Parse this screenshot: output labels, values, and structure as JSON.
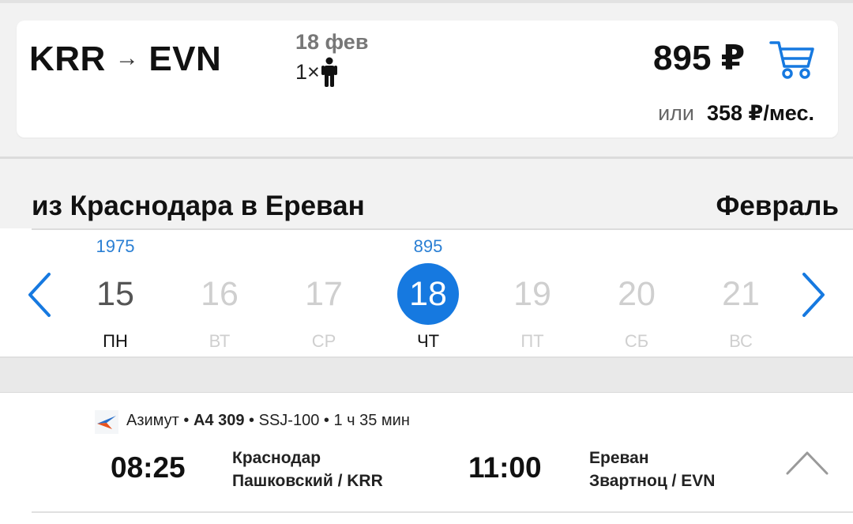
{
  "summary": {
    "origin": "KRR",
    "arrow": "→",
    "destination": "EVN",
    "date": "18 фев",
    "passengers": "1×",
    "price": "895 ₽",
    "installment_prefix": "или",
    "installment_amount": "358 ₽/мес."
  },
  "section": {
    "route_title": "из Краснодара в Ереван",
    "month": "Февраль"
  },
  "calendar": {
    "days": [
      {
        "price": "1975",
        "num": "15",
        "weekday": "ПН",
        "state": "available"
      },
      {
        "price": "",
        "num": "16",
        "weekday": "ВТ",
        "state": "disabled"
      },
      {
        "price": "",
        "num": "17",
        "weekday": "СР",
        "state": "disabled"
      },
      {
        "price": "895",
        "num": "18",
        "weekday": "ЧТ",
        "state": "selected"
      },
      {
        "price": "",
        "num": "19",
        "weekday": "ПТ",
        "state": "disabled"
      },
      {
        "price": "",
        "num": "20",
        "weekday": "СБ",
        "state": "disabled"
      },
      {
        "price": "",
        "num": "21",
        "weekday": "ВС",
        "state": "disabled"
      }
    ]
  },
  "flight": {
    "airline": "Азимут",
    "sep": "•",
    "number": "А4 309",
    "aircraft": "SSJ-100",
    "duration": "1 ч 35 мин",
    "dep_time": "08:25",
    "dep_city": "Краснодар",
    "dep_airport": "Пашковский / KRR",
    "arr_time": "11:00",
    "arr_city": "Ереван",
    "arr_airport": "Звартноц / EVN"
  },
  "colors": {
    "accent": "#1679e0",
    "price_text": "#2a7fd4",
    "disabled": "#cfcfcf"
  },
  "icons": {
    "cart": "cart-icon",
    "passenger": "person-icon",
    "prev": "chevron-left-icon",
    "next": "chevron-right-icon",
    "collapse": "chevron-up-icon",
    "airline": "azimut-logo"
  }
}
